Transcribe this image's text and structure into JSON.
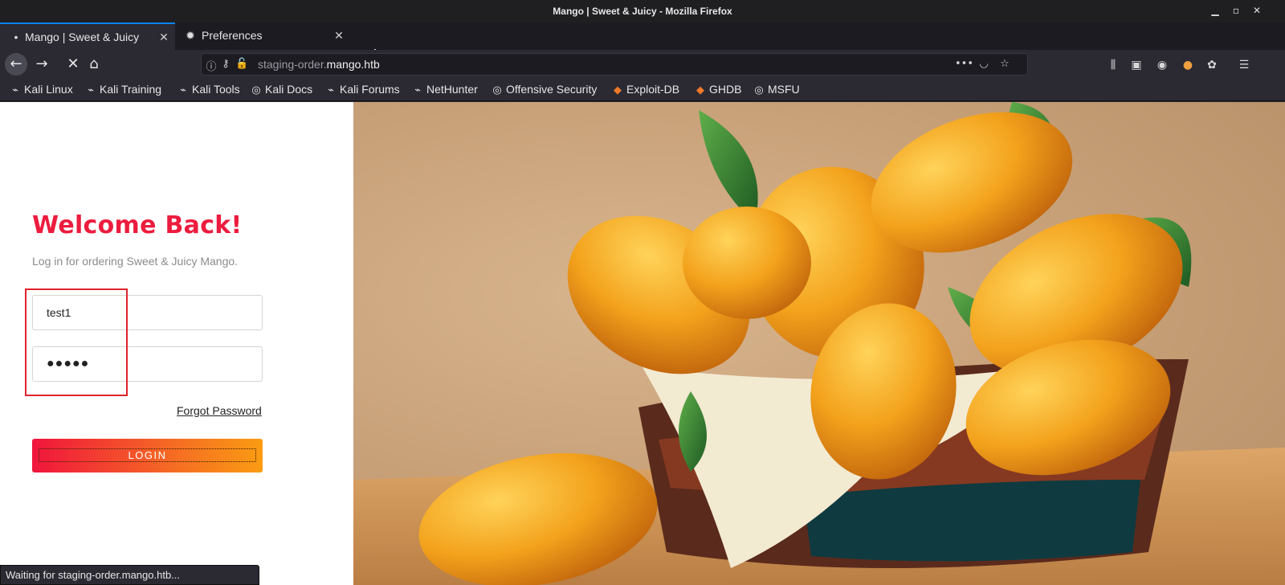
{
  "window": {
    "title": "Mango | Sweet & Juicy - Mozilla Firefox"
  },
  "tabs": [
    {
      "label": "Mango | Sweet & Juicy",
      "icon": "loading-dot-icon"
    },
    {
      "label": "Preferences",
      "icon": "gear-icon"
    }
  ],
  "urlbar": {
    "prefix": "staging-order.",
    "host": "mango.htb"
  },
  "bookmarks": [
    {
      "label": "Kali Linux",
      "icon": "kali-dragon-icon"
    },
    {
      "label": "Kali Training",
      "icon": "kali-dragon-icon"
    },
    {
      "label": "Kali Tools",
      "icon": "kali-dragon-icon"
    },
    {
      "label": "Kali Docs",
      "icon": "globe-icon"
    },
    {
      "label": "Kali Forums",
      "icon": "kali-dragon-icon"
    },
    {
      "label": "NetHunter",
      "icon": "kali-dragon-icon"
    },
    {
      "label": "Offensive Security",
      "icon": "globe-icon"
    },
    {
      "label": "Exploit-DB",
      "icon": "exploit-db-icon"
    },
    {
      "label": "GHDB",
      "icon": "exploit-db-icon"
    },
    {
      "label": "MSFU",
      "icon": "globe-icon"
    }
  ],
  "login": {
    "heading": "Welcome Back!",
    "subtitle": "Log in for ordering Sweet & Juicy Mango.",
    "username_value": "test1",
    "password_value": "●●●●●",
    "forgot_label": "Forgot Password",
    "login_label": "LOGIN"
  },
  "status": {
    "text": "Waiting for staging-order.mango.htb..."
  },
  "colors": {
    "accent": "#ec1c3e",
    "button_start": "#f0153c",
    "button_end": "#fa9c12"
  }
}
